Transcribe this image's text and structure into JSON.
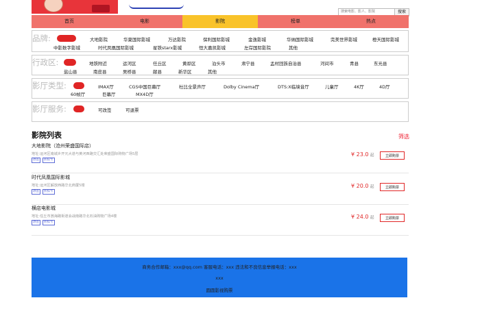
{
  "header": {
    "search_placeholder": "搜索电影、影人、影院",
    "search_button": "搜索"
  },
  "nav": [
    {
      "label": "首页"
    },
    {
      "label": "电影"
    },
    {
      "label": "影院",
      "active": true
    },
    {
      "label": "榜单"
    },
    {
      "label": "热点"
    }
  ],
  "filters": {
    "brand": {
      "label": "品牌:",
      "items": [
        "大地影院",
        "华夏国际影城",
        "万达影院",
        "保利国际影城",
        "金逸影城",
        "华纳国际影城",
        "完美世界影城",
        "橙天国际影城",
        "中影数字影城",
        "时代凤凰国际影城",
        "星铁starx影城",
        "恒大嘉凯影城",
        "左岸国际影院",
        "其他"
      ]
    },
    "district": {
      "label": "行政区:",
      "items": [
        "地铁附近",
        "运河区",
        "任丘区",
        "黄骅区",
        "泊头市",
        "肃宁县",
        "孟村回族自治县",
        "河间市",
        "青县",
        "东光县",
        "盐山县",
        "南皮县",
        "吴桥县",
        "献县",
        "新华区",
        "其他"
      ]
    },
    "hall": {
      "label": "影厅类型:",
      "items": [
        "IMAX厅",
        "CGS中国巨幕厅",
        "杜比全景声厅",
        "Dolby Cinema厅",
        "DTS:X临境音厅",
        "儿童厅",
        "4K厅",
        "4D厅",
        "60帧厅",
        "巨幕厅",
        "MX4D厅"
      ]
    },
    "service": {
      "label": "影厅服务:",
      "items": [
        "可改签",
        "可退票"
      ]
    }
  },
  "list": {
    "title": "影院列表",
    "filter_link": "筛选",
    "cinemas": [
      {
        "name": "大地影院（沧州荣盛国际店）",
        "address": "地址:运河区南城乡开元大道与黄河西路交汇处荣盛国际购物广场5层",
        "tags": [
          "改签",
          "折扣卡"
        ],
        "price": "¥ 23.0",
        "unit": "起",
        "button": "立即购票"
      },
      {
        "name": "时代凤凰国际影城",
        "address": "地址:运河区解放西路华北商厦5楼",
        "tags": [
          "改签",
          "折扣卡"
        ],
        "price": "¥ 20.0",
        "unit": "起",
        "button": "立即购票"
      },
      {
        "name": "横店电影城",
        "address": "地址:任丘市渤海路街道会战南路华北石油购物广场4楼",
        "tags": [
          "改签",
          "折扣卡"
        ],
        "price": "¥ 24.0",
        "unit": "起",
        "button": "立即购票"
      }
    ]
  },
  "footer": {
    "line1": "商务合作邮箱：xxx@qq.com 客服电话：xxx 违法和不良信息举报电话：xxx",
    "line2": "xxx",
    "line3": "圆圆影视购票"
  },
  "colors": {
    "nav_bg": "#f0726b",
    "nav_active": "#f9c32a",
    "accent_red": "#e02525",
    "footer_bg": "#1a73e8"
  }
}
